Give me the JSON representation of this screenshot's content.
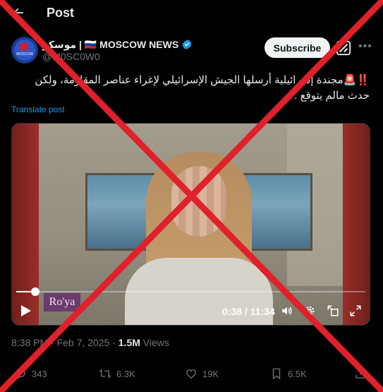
{
  "header": {
    "title": "Post"
  },
  "post": {
    "author_name": "موسكو | 🇷🇺 MOSCOW NEWS",
    "handle": "@M0SC0W0",
    "avatar_text": "MOSCOW",
    "subscribe_label": "Subscribe",
    "text": "‼️🚨مجندة إسرائيلية أرسلها الجيش الإسرائيلي لإغراء عناصر المقاومة، ولكن حدث مالم يتوقع .",
    "translate_label": "Translate post",
    "video": {
      "watermark": "Ro'ya",
      "current_time": "0:38",
      "duration": "11:34",
      "time_display": "0:38 / 11:34",
      "progress_fraction": 0.055
    },
    "timestamp": "8:38 PM · Feb 7, 2025",
    "views_count": "1.5M",
    "views_label": "Views",
    "replies": "343",
    "reposts": "6.3K",
    "likes": "19K",
    "bookmarks": "6.5K"
  },
  "colors": {
    "accent": "#1d9bf0",
    "cross": "#e0202b",
    "secondary_text": "#71767b",
    "background": "#000000"
  },
  "icons": [
    "back-arrow-icon",
    "verified-badge-icon",
    "grok-icon",
    "more-icon",
    "play-icon",
    "volume-icon",
    "settings-icon",
    "pip-icon",
    "fullscreen-icon",
    "reply-icon",
    "repost-icon",
    "like-icon",
    "bookmark-icon",
    "share-icon"
  ]
}
